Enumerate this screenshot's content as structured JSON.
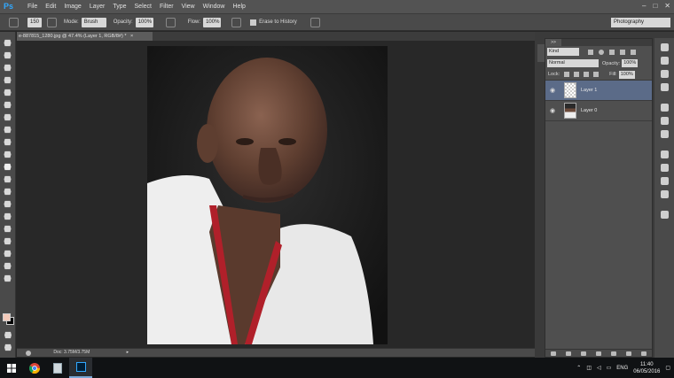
{
  "app": {
    "logo": "Ps"
  },
  "menu": [
    "File",
    "Edit",
    "Image",
    "Layer",
    "Type",
    "Select",
    "Filter",
    "View",
    "Window",
    "Help"
  ],
  "window_controls": [
    "–",
    "□",
    "✕"
  ],
  "options": {
    "brush_size": "150",
    "mode_label": "Mode:",
    "mode_value": "Brush",
    "opacity_label": "Opacity:",
    "opacity_value": "100%",
    "flow_label": "Flow:",
    "flow_value": "100%",
    "erase_history_label": "Erase to History",
    "workspace": "Photography"
  },
  "document": {
    "tab_title": "e-887815_1280.jpg @ 47.4% (Layer 1, RGB/8#) *",
    "close": "×"
  },
  "status": {
    "doc_size": "Doc: 3.75M/3.75M"
  },
  "layers_panel": {
    "tab_label": ">>",
    "filter_kind": "Kind",
    "blend_mode": "Normal",
    "opacity_label": "Opacity:",
    "opacity_value": "100%",
    "lock_label": "Lock:",
    "fill_label": "Fill:",
    "fill_value": "100%",
    "layers": [
      {
        "name": "Layer 1",
        "selected": true
      },
      {
        "name": "Layer 0",
        "selected": false
      }
    ]
  },
  "taskbar": {
    "language": "ENG",
    "time": "11:40",
    "date": "06/05/2016"
  },
  "colors": {
    "foreground": "#f3c9b9",
    "background": "#000000",
    "selected_layer": "#5b6b88",
    "photoshop_blue": "#31a8ff"
  }
}
